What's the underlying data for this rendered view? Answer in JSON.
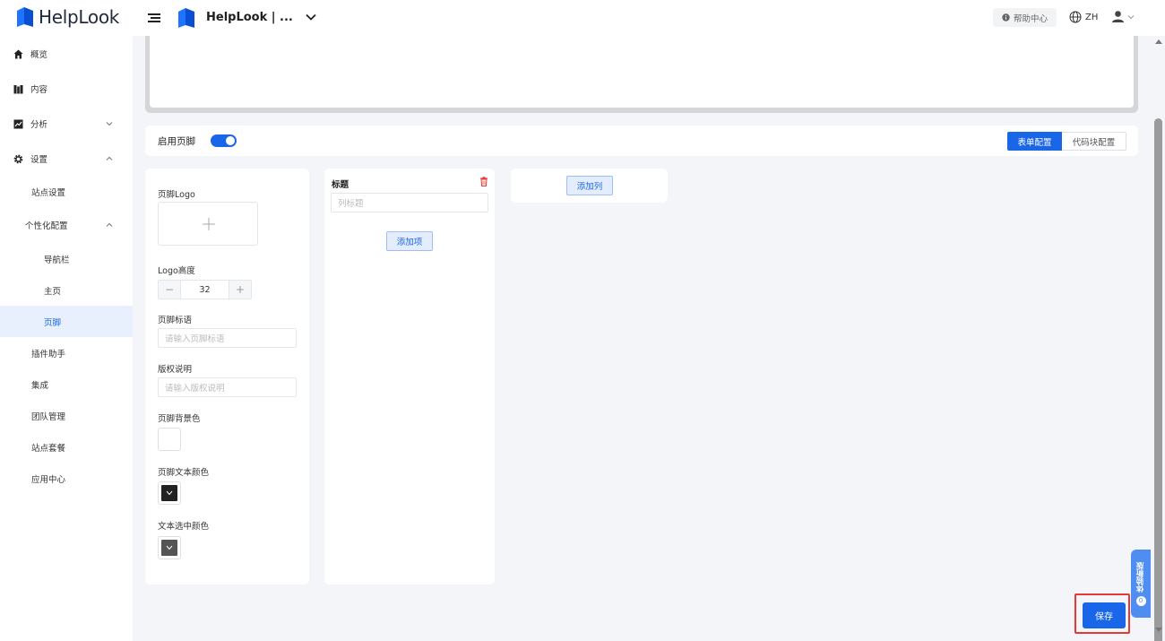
{
  "header": {
    "brand": "HelpLook",
    "site_name": "HelpLook | ...",
    "help_label": "帮助中心",
    "lang_label": "ZH"
  },
  "sidebar": {
    "items": [
      {
        "label": "概览",
        "icon": "home-icon"
      },
      {
        "label": "内容",
        "icon": "book-icon"
      },
      {
        "label": "分析",
        "icon": "chart-icon"
      },
      {
        "label": "设置",
        "icon": "gear-icon"
      },
      {
        "label": "站点设置"
      },
      {
        "label": "个性化配置"
      },
      {
        "label": "导航栏"
      },
      {
        "label": "主页"
      },
      {
        "label": "页脚"
      },
      {
        "label": "插件助手"
      },
      {
        "label": "集成"
      },
      {
        "label": "团队管理"
      },
      {
        "label": "站点套餐"
      },
      {
        "label": "应用中心"
      }
    ]
  },
  "footer_config": {
    "enable_label": "启用页脚",
    "enabled": true,
    "mode_tabs": [
      "表单配置",
      "代码块配置"
    ],
    "active_tab": "表单配置"
  },
  "form": {
    "logo_label": "页脚Logo",
    "logo_height_label": "Logo高度",
    "logo_height_value": "32",
    "slogan_label": "页脚标语",
    "slogan_placeholder": "请输入页脚标语",
    "copyright_label": "版权说明",
    "copyright_placeholder": "请输入版权说明",
    "bg_color_label": "页脚背景色",
    "bg_color": "#ffffff",
    "text_color_label": "页脚文本颜色",
    "text_color": "#222222",
    "selected_color_label": "文本选中颜色",
    "selected_color": "#555555"
  },
  "column": {
    "title_label": "标题",
    "title_placeholder": "列标题",
    "add_item_label": "添加项"
  },
  "add_column_label": "添加列",
  "save_label": "保存",
  "float_tab": {
    "label": "体验新版",
    "badge": "0"
  },
  "colors": {
    "accent": "#1a66e8",
    "danger": "#e53935"
  }
}
